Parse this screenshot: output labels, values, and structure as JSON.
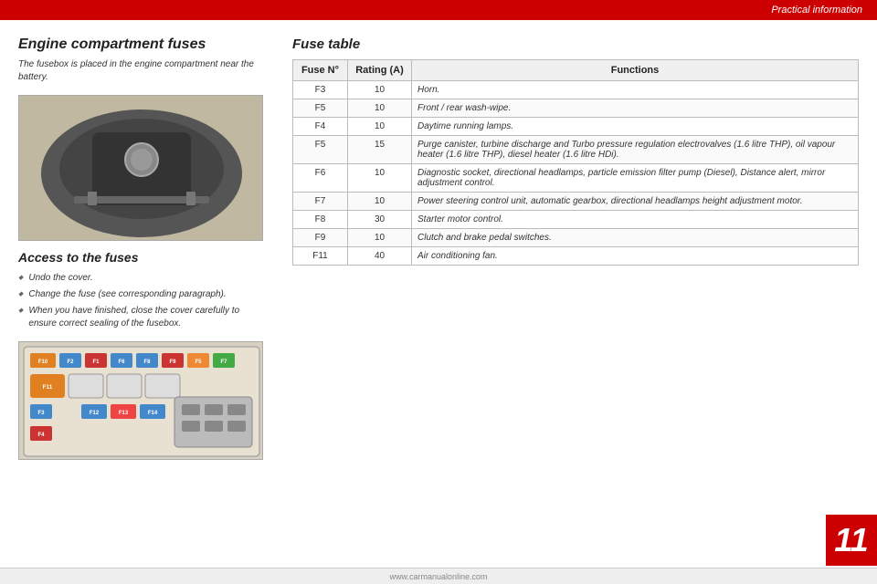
{
  "header": {
    "title": "Practical information"
  },
  "left": {
    "engine_section_title": "Engine compartment fuses",
    "engine_section_desc": "The fusebox is placed in the engine compartment near the battery.",
    "access_title": "Access to the fuses",
    "bullets": [
      "Undo the cover.",
      "Change the fuse (see corresponding paragraph).",
      "When you have finished, close the cover carefully to ensure correct sealing of the fusebox."
    ]
  },
  "right": {
    "fuse_table_title": "Fuse table",
    "table_headers": {
      "fuse_no": "Fuse N°",
      "rating": "Rating (A)",
      "functions": "Functions"
    },
    "rows": [
      {
        "fuse": "F3",
        "rating": "10",
        "functions": "Horn."
      },
      {
        "fuse": "F5",
        "rating": "10",
        "functions": "Front / rear wash-wipe."
      },
      {
        "fuse": "F4",
        "rating": "10",
        "functions": "Daytime running lamps."
      },
      {
        "fuse": "F5",
        "rating": "15",
        "functions": "Purge canister, turbine discharge and Turbo pressure regulation electrovalves (1.6 litre THP), oil vapour heater (1.6 litre THP), diesel heater (1.6 litre HDi)."
      },
      {
        "fuse": "F6",
        "rating": "10",
        "functions": "Diagnostic socket, directional headlamps, particle emission filter pump (Diesel), Distance alert, mirror adjustment control."
      },
      {
        "fuse": "F7",
        "rating": "10",
        "functions": "Power steering control unit, automatic gearbox, directional headlamps height adjustment motor."
      },
      {
        "fuse": "F8",
        "rating": "30",
        "functions": "Starter motor control."
      },
      {
        "fuse": "F9",
        "rating": "10",
        "functions": "Clutch and brake pedal switches."
      },
      {
        "fuse": "F11",
        "rating": "40",
        "functions": "Air conditioning fan."
      }
    ]
  },
  "page_number": "11",
  "bottom_bar": {
    "text": "www.carmanualonline.com"
  },
  "fuse_chips": [
    {
      "label": "F10",
      "color": "#e08020"
    },
    {
      "label": "F2",
      "color": "#4488cc"
    },
    {
      "label": "F1",
      "color": "#cc3333"
    },
    {
      "label": "F6",
      "color": "#4488cc"
    },
    {
      "label": "F8",
      "color": "#4488cc"
    },
    {
      "label": "F9",
      "color": "#cc3333"
    },
    {
      "label": "F5",
      "color": "#cc8844"
    },
    {
      "label": "F7",
      "color": "#44aa44"
    },
    {
      "label": "F11",
      "color": "#e08020"
    },
    {
      "label": "F3",
      "color": "#44aacc"
    },
    {
      "label": "F12",
      "color": "#4488cc"
    },
    {
      "label": "F13",
      "color": "#4488cc"
    },
    {
      "label": "F14",
      "color": "#4488cc"
    },
    {
      "label": "F4",
      "color": "#cc3333"
    }
  ]
}
